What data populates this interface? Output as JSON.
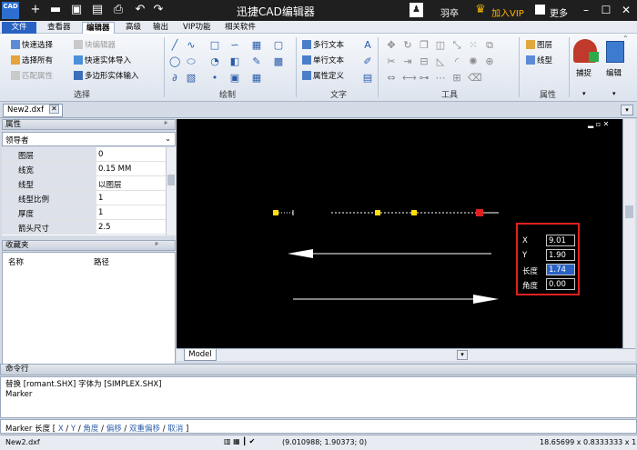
{
  "titlebar": {
    "logo": "CAD",
    "title": "迅捷CAD编辑器",
    "user_name": "羽卒",
    "vip_label": "加入VIP",
    "more_label": "更多"
  },
  "menu_tabs": [
    "文件",
    "查看器",
    "编辑器",
    "高级",
    "输出",
    "VIP功能",
    "相关软件"
  ],
  "ribbon": {
    "select_group": {
      "items": [
        "快速选择",
        "选择所有",
        "匹配属性",
        "块编辑器",
        "快速实体导入",
        "多边形实体输入"
      ],
      "label": "选择"
    },
    "draw_group_label": "绘制",
    "text_group": {
      "items": [
        "多行文本",
        "单行文本",
        "属性定义"
      ],
      "label": "文字"
    },
    "tools_group_label": "工具",
    "props_group": {
      "items": [
        "图层",
        "线型"
      ],
      "label": "属性"
    },
    "snap_label": "捕捉",
    "edit_label": "编辑"
  },
  "doc_tab": "New2.dxf",
  "properties": {
    "header": "属性",
    "pin": "ᵖ",
    "selected": "领导者",
    "rows": [
      {
        "k": "图层",
        "v": "0"
      },
      {
        "k": "线宽",
        "v": "0.15 MM"
      },
      {
        "k": "线型",
        "v": "以图层"
      },
      {
        "k": "线型比例",
        "v": "1"
      },
      {
        "k": "厚度",
        "v": "1"
      },
      {
        "k": "箭头尺寸",
        "v": "2.5"
      }
    ]
  },
  "favorites": {
    "header": "收藏夹",
    "col_name": "名称",
    "col_path": "路径"
  },
  "canvas": {
    "model_tab": "Model",
    "dyn_input": {
      "x_label": "X",
      "x_value": "9.01",
      "y_label": "Y",
      "y_value": "1.90",
      "len_label": "长度",
      "len_value": "1.74",
      "angle_label": "角度",
      "angle_value": "0.00"
    }
  },
  "command": {
    "header": "命令行",
    "history": [
      "替换 [romant.SHX] 字体为 [SIMPLEX.SHX]",
      "Marker"
    ],
    "prompt": "Marker  长度  [",
    "options": [
      "X",
      "Y",
      "角度",
      "偏移",
      "双重偏移",
      "取消"
    ],
    "close": "]"
  },
  "status": {
    "file": "New2.dxf",
    "coords": "(9.010988; 1.90373; 0)",
    "size": "18.65699 x 0.8333333 x 1"
  },
  "colors": {
    "accent": "#2a62c4",
    "dyn_border": "#e02020",
    "vip": "#ffb400"
  }
}
